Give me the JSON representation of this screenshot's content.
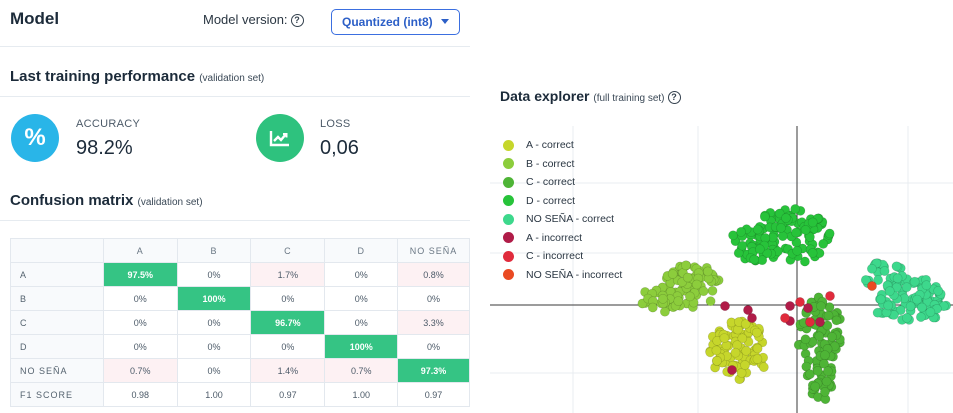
{
  "header": {
    "title": "Model",
    "version_label": "Model version:",
    "version_value": "Quantized (int8)"
  },
  "performance": {
    "title": "Last training performance",
    "subtitle": "(validation set)",
    "accuracy": {
      "icon": "percent-icon",
      "label": "ACCURACY",
      "value": "98.2%",
      "color": "#29b5e8"
    },
    "loss": {
      "icon": "chart-icon",
      "label": "LOSS",
      "value": "0,06",
      "color": "#2ec27e"
    }
  },
  "confusion": {
    "title": "Confusion matrix",
    "subtitle": "(validation set)",
    "columns": [
      "A",
      "B",
      "C",
      "D",
      "NO SEÑA"
    ],
    "rows": [
      {
        "label": "A",
        "cells": [
          "97.5%",
          "0%",
          "1.7%",
          "0%",
          "0.8%"
        ]
      },
      {
        "label": "B",
        "cells": [
          "0%",
          "100%",
          "0%",
          "0%",
          "0%"
        ]
      },
      {
        "label": "C",
        "cells": [
          "0%",
          "0%",
          "96.7%",
          "0%",
          "3.3%"
        ]
      },
      {
        "label": "D",
        "cells": [
          "0%",
          "0%",
          "0%",
          "100%",
          "0%"
        ]
      },
      {
        "label": "NO SEÑA",
        "cells": [
          "0.7%",
          "0%",
          "1.4%",
          "0.7%",
          "97.3%"
        ]
      }
    ],
    "f1": {
      "label": "F1 SCORE",
      "cells": [
        "0.98",
        "1.00",
        "0.97",
        "1.00",
        "0.97"
      ]
    }
  },
  "explorer": {
    "title": "Data explorer",
    "subtitle": "(full training set)",
    "legend": [
      {
        "label": "A - correct",
        "color": "#c6d62b"
      },
      {
        "label": "B - correct",
        "color": "#8ccd3c"
      },
      {
        "label": "C - correct",
        "color": "#4eb436"
      },
      {
        "label": "D - correct",
        "color": "#27c33a"
      },
      {
        "label": "NO SEÑA - correct",
        "color": "#3dd88c"
      },
      {
        "label": "A - incorrect",
        "color": "#b01c48"
      },
      {
        "label": "C - incorrect",
        "color": "#e02b3c"
      },
      {
        "label": "NO SEÑA - incorrect",
        "color": "#ea4a22"
      }
    ]
  }
}
